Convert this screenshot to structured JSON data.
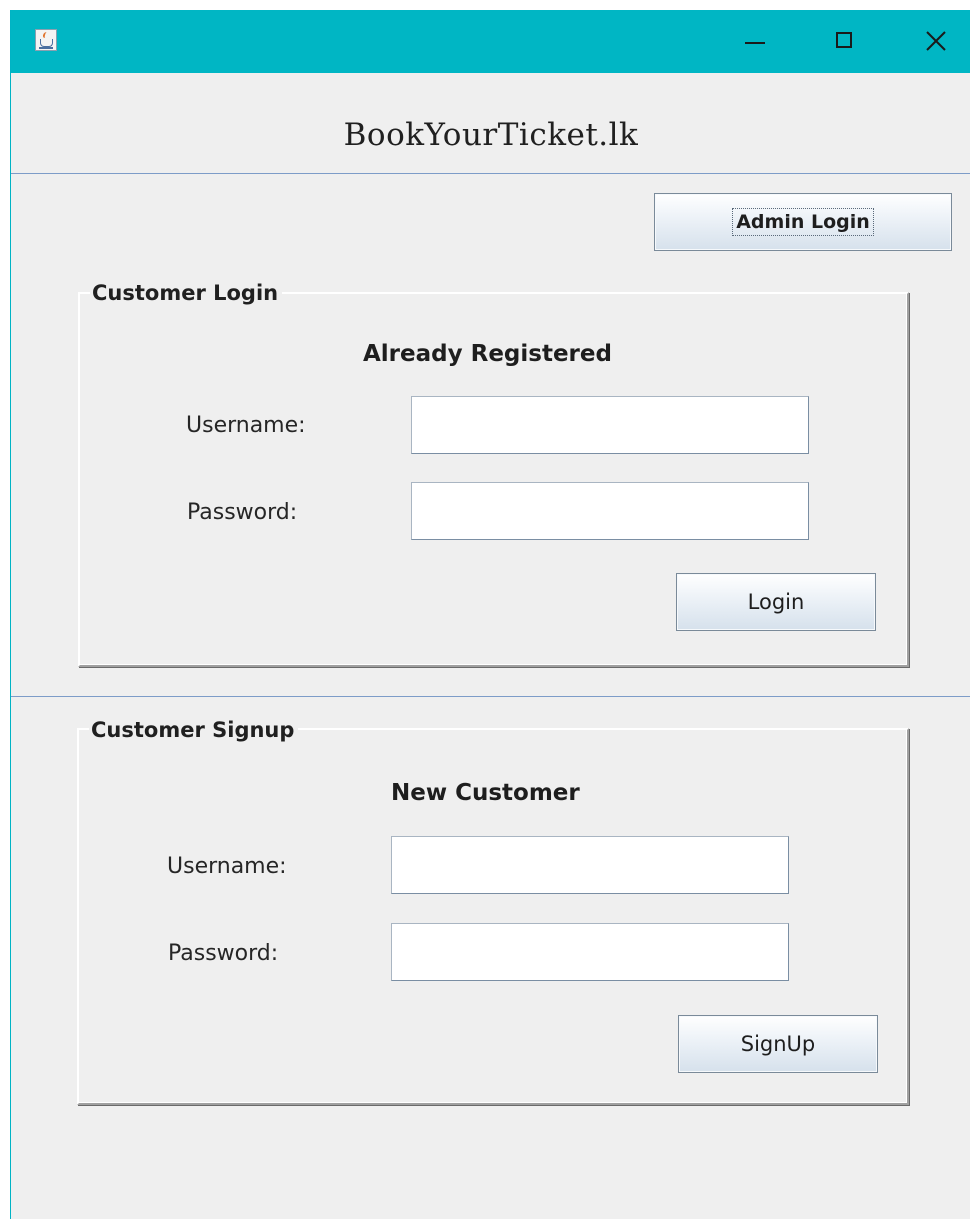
{
  "window": {
    "title": "",
    "controls": {
      "minimize": "minimize-icon",
      "maximize": "maximize-icon",
      "close": "close-icon"
    },
    "titlebar_color": "#00b6c4"
  },
  "header": {
    "brand": "BookYourTicket.lk"
  },
  "admin": {
    "button_label": "Admin Login"
  },
  "login": {
    "group_title": "Customer Login",
    "heading": "Already Registered",
    "username_label": "Username:",
    "username_value": "",
    "password_label": "Password:",
    "password_value": "",
    "button_label": "Login"
  },
  "signup": {
    "group_title": "Customer Signup",
    "heading": "New Customer",
    "username_label": "Username:",
    "username_value": "",
    "password_label": "Password:",
    "password_value": "",
    "button_label": "SignUp"
  }
}
